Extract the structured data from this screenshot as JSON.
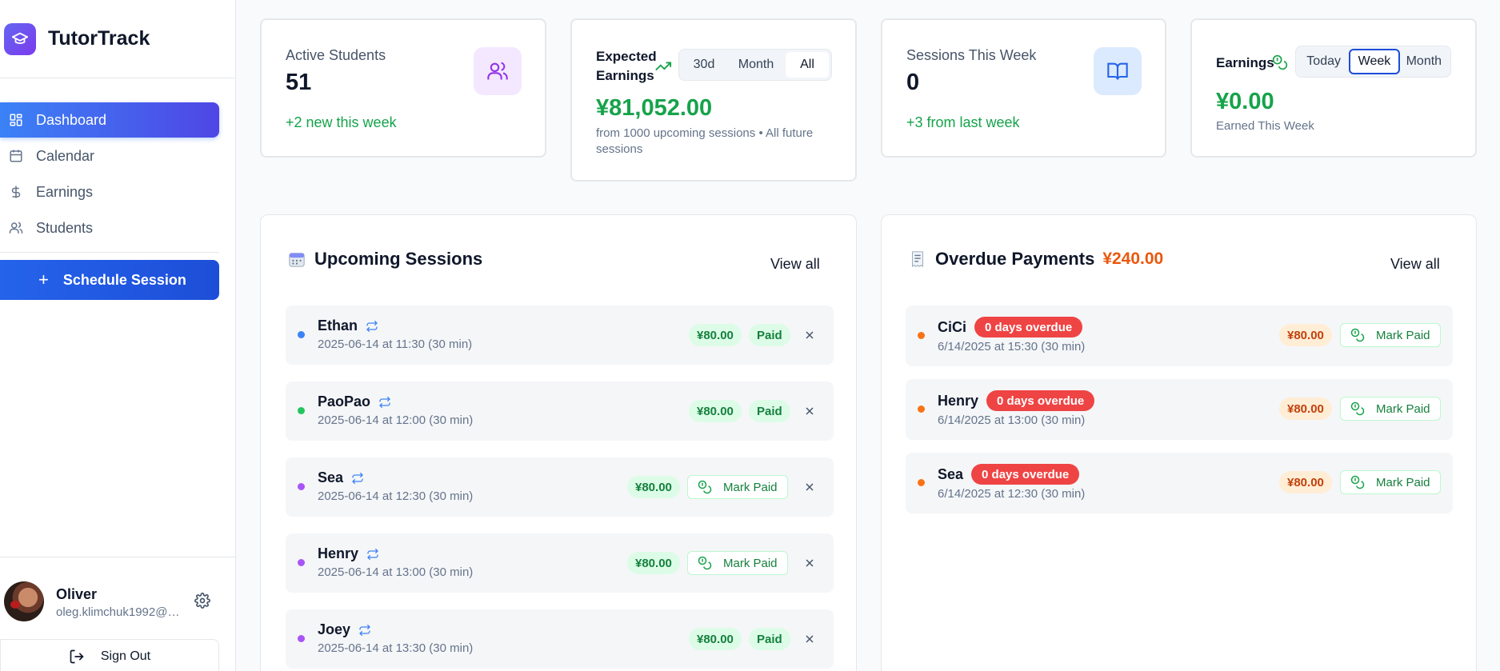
{
  "app": {
    "name": "TutorTrack"
  },
  "sidebar": {
    "items": [
      {
        "label": "Dashboard",
        "icon": "dashboard-icon",
        "active": true
      },
      {
        "label": "Calendar",
        "icon": "calendar-icon"
      },
      {
        "label": "Earnings",
        "icon": "dollar-icon"
      },
      {
        "label": "Students",
        "icon": "users-icon"
      }
    ],
    "schedule_button": "Schedule Session",
    "user": {
      "name": "Oliver",
      "email": "oleg.klimchuk1992@g..."
    },
    "sign_out": "Sign Out"
  },
  "stats": {
    "active_students": {
      "title": "Active Students",
      "value": "51",
      "sub": "+2 new this week"
    },
    "expected_earnings": {
      "title_line1": "Expected",
      "title_line2": "Earnings",
      "tabs": [
        "30d",
        "Month",
        "All"
      ],
      "selected_tab": "All",
      "value": "¥81,052.00",
      "sub_line1": "from 1000 upcoming sessions • All future",
      "sub_line2": "sessions"
    },
    "sessions_week": {
      "title": "Sessions This Week",
      "value": "0",
      "sub": "+3 from last week"
    },
    "earnings": {
      "title": "Earnings",
      "tabs": [
        "Today",
        "Week",
        "Month"
      ],
      "selected_tab": "Week",
      "value": "¥0.00",
      "sub": "Earned This Week"
    }
  },
  "upcoming": {
    "title": "Upcoming Sessions",
    "view_all": "View all",
    "sessions": [
      {
        "name": "Ethan",
        "datetime": "2025-06-14 at 11:30 (30 min)",
        "amount": "¥80.00",
        "status": "Paid",
        "dot_color": "#3b82f6"
      },
      {
        "name": "PaoPao",
        "datetime": "2025-06-14 at 12:00 (30 min)",
        "amount": "¥80.00",
        "status": "Paid",
        "dot_color": "#22c55e"
      },
      {
        "name": "Sea",
        "datetime": "2025-06-14 at 12:30 (30 min)",
        "amount": "¥80.00",
        "status": "Mark Paid",
        "dot_color": "#a855f7"
      },
      {
        "name": "Henry",
        "datetime": "2025-06-14 at 13:00 (30 min)",
        "amount": "¥80.00",
        "status": "Mark Paid",
        "dot_color": "#a855f7"
      },
      {
        "name": "Joey",
        "datetime": "2025-06-14 at 13:30 (30 min)",
        "amount": "¥80.00",
        "status": "Paid",
        "dot_color": "#a855f7"
      }
    ]
  },
  "overdue": {
    "title": "Overdue Payments",
    "total": "¥240.00",
    "view_all": "View all",
    "payments": [
      {
        "name": "CiCi",
        "badge": "0 days overdue",
        "datetime": "6/14/2025 at 15:30 (30 min)",
        "amount": "¥80.00",
        "action": "Mark Paid"
      },
      {
        "name": "Henry",
        "badge": "0 days overdue",
        "datetime": "6/14/2025 at 13:00 (30 min)",
        "amount": "¥80.00",
        "action": "Mark Paid"
      },
      {
        "name": "Sea",
        "badge": "0 days overdue",
        "datetime": "6/14/2025 at 12:30 (30 min)",
        "amount": "¥80.00",
        "action": "Mark Paid"
      }
    ]
  },
  "colors": {
    "accent": "#2563eb",
    "success": "#16a34a",
    "danger": "#ef4444",
    "warning": "#ea580c"
  }
}
